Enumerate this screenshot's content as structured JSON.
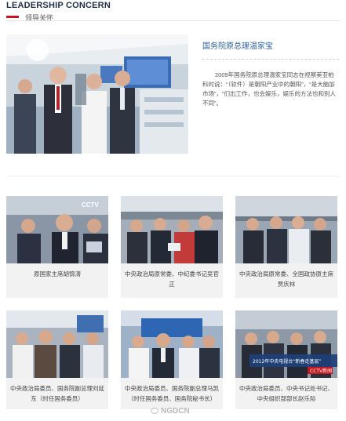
{
  "header": {
    "title": "LEADERSHIP CONCERN",
    "subtitle": "领导关怀"
  },
  "feature": {
    "name": "国务院原总理温家宝",
    "description": "2009年国务院原总理温家宝同志在视察美亚柏科时说：“（软件）是朝阳产业中的朝阳”，“是大脑加市场”，“们出工作，也会娱乐，娱乐的方法也和别人不同”。"
  },
  "cards": [
    {
      "caption": "原国家主席胡锦涛"
    },
    {
      "caption": "中央政治局原常委、中纪委书记吴官正"
    },
    {
      "caption": "中央政治局原常委、全国政协原主席贾庆林"
    },
    {
      "caption": "中央政治局委员、国务院副总理刘延东（时任国务委员）"
    },
    {
      "caption": "中央政治局委员、国务院副总理马凯（时任国务委员、国务院秘书长）"
    },
    {
      "caption": "中央政治局委员、中央书记处书记、中央组织部部长赵乐际"
    }
  ],
  "photo_texts": {
    "tv_logo": "CCTV",
    "screen_banner": "2012年中央电视台“新春走基层”",
    "screen_badge": "CCTV新闻"
  },
  "watermark": "NGDCN",
  "colors": {
    "accent_red": "#c8161d",
    "title_navy": "#1f2f4a",
    "link_blue": "#2a5f9e",
    "card_bg": "#f2f2f2"
  }
}
